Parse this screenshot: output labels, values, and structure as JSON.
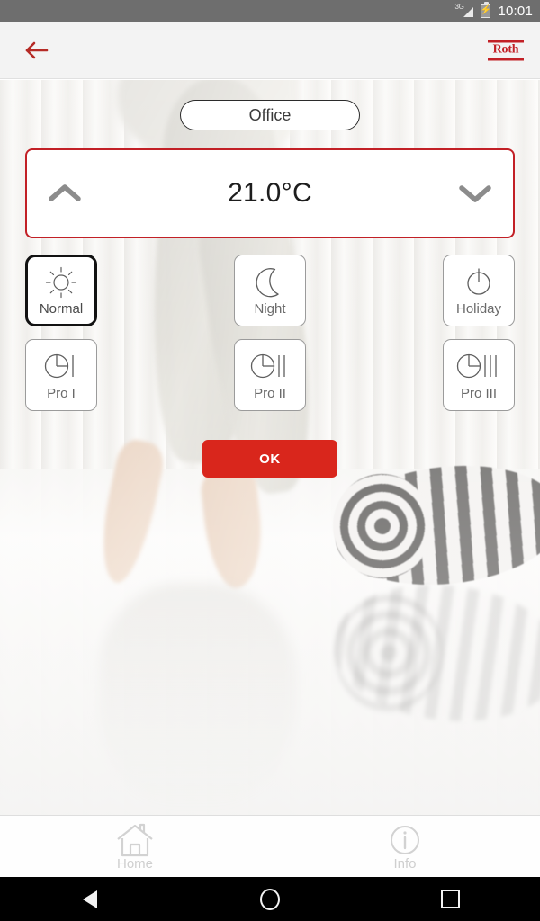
{
  "statusbar": {
    "network_label": "3G",
    "network_icon": "signal-3g-icon",
    "battery_icon": "battery-charging-icon",
    "clock": "10:01"
  },
  "appbar": {
    "back_icon": "back-arrow-icon",
    "brand": "Roth",
    "brand_color": "#c22026"
  },
  "main": {
    "room": {
      "label": "Office"
    },
    "temperature": {
      "value": "21.0°C",
      "increase_icon": "chevron-up-icon",
      "decrease_icon": "chevron-down-icon",
      "border_color": "#c22026"
    },
    "modes": [
      {
        "label": "Normal",
        "icon": "sun-icon",
        "selected": true
      },
      {
        "label": "Night",
        "icon": "moon-icon",
        "selected": false
      },
      {
        "label": "Holiday",
        "icon": "power-icon",
        "selected": false
      },
      {
        "label": "Pro I",
        "icon": "clock-one-icon",
        "selected": false
      },
      {
        "label": "Pro II",
        "icon": "clock-two-icon",
        "selected": false
      },
      {
        "label": "Pro III",
        "icon": "clock-three-icon",
        "selected": false
      }
    ],
    "confirm": {
      "label": "OK",
      "color": "#d9261c"
    }
  },
  "tabbar": {
    "items": [
      {
        "label": "Home",
        "icon": "house-icon"
      },
      {
        "label": "Info",
        "icon": "info-circle-icon"
      }
    ]
  },
  "navbar": {
    "back": "nav-back-icon",
    "home": "nav-home-icon",
    "recents": "nav-recents-icon"
  }
}
